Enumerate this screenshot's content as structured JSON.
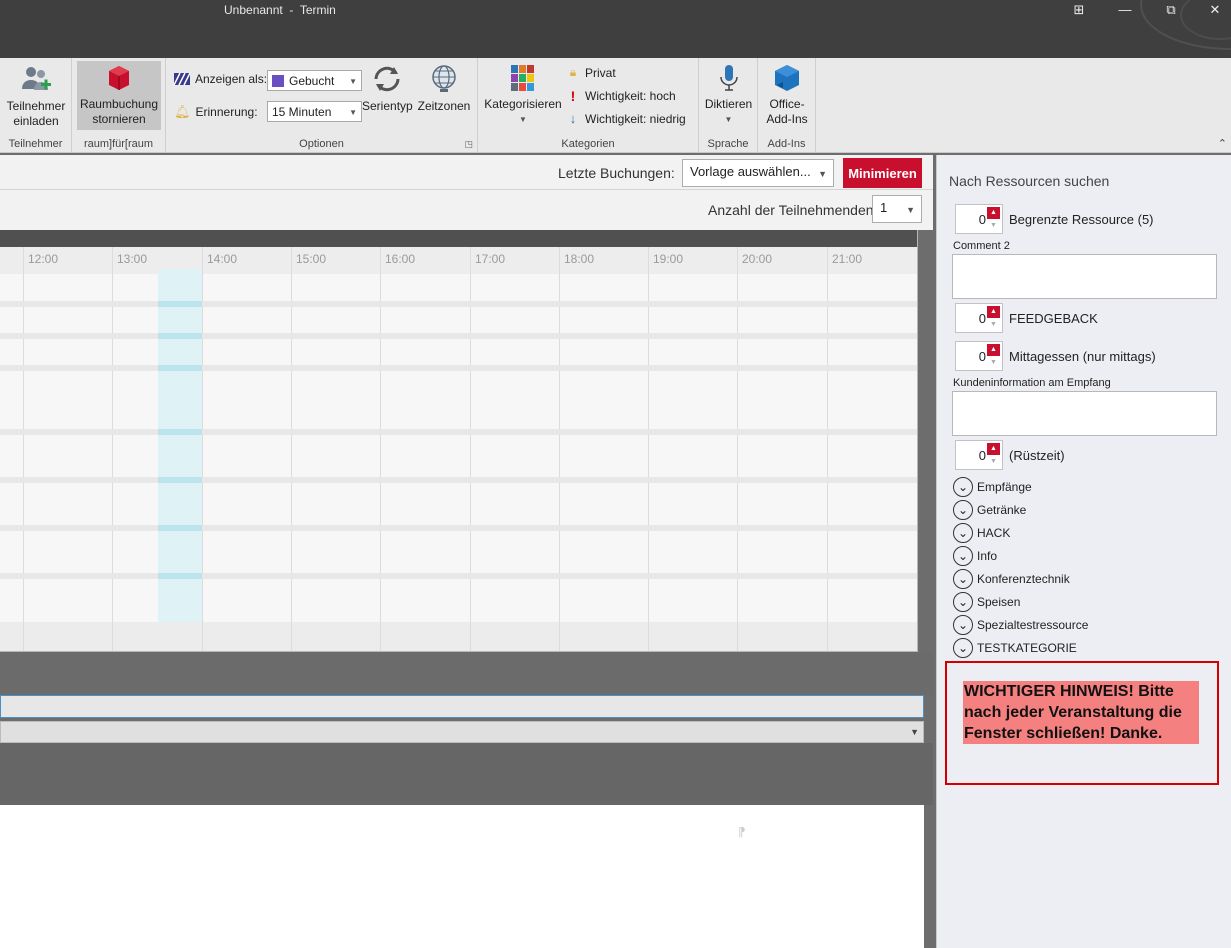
{
  "window": {
    "title": "Unbenannt  -  Termin",
    "controls": {
      "ribbon_display": "⊞",
      "minimize": "—",
      "restore": "⧉",
      "close": "✕"
    }
  },
  "ribbon": {
    "groups": {
      "teilnehmer": {
        "label": "Teilnehmer",
        "invite_line1": "Teilnehmer",
        "invite_line2": "einladen"
      },
      "raum": {
        "label": "raum]für[raum",
        "cancel_line1": "Raumbuchung",
        "cancel_line2": "stornieren"
      },
      "optionen": {
        "label": "Optionen",
        "anzeigen_label": "Anzeigen als:",
        "anzeigen_value": "Gebucht",
        "erinnerung_label": "Erinnerung:",
        "erinnerung_value": "15 Minuten",
        "serientyp": "Serientyp",
        "zeitzonen": "Zeitzonen"
      },
      "kategorien": {
        "label": "Kategorien",
        "kategorisieren": "Kategorisieren",
        "privat": "Privat",
        "wichtigkeit_hoch": "Wichtigkeit: hoch",
        "wichtigkeit_niedrig": "Wichtigkeit: niedrig"
      },
      "sprache": {
        "label": "Sprache",
        "diktieren": "Diktieren"
      },
      "addins": {
        "label": "Add-Ins",
        "line1": "Office-",
        "line2": "Add-Ins"
      }
    }
  },
  "booking": {
    "letzte_label": "Letzte Buchungen:",
    "vorlage_value": "Vorlage auswählen...",
    "minimize_button": "Minimieren",
    "teilnehmende_label": "Anzahl der Teilnehmenden",
    "teilnehmende_value": "1"
  },
  "timeline": {
    "hours": [
      "12:00",
      "13:00",
      "14:00",
      "15:00",
      "16:00",
      "17:00",
      "18:00",
      "19:00",
      "20:00",
      "21:00"
    ]
  },
  "resources": {
    "title": "Nach Ressourcen suchen",
    "spinners": [
      {
        "value": "0",
        "label": "Begrenzte Ressource (5)"
      },
      {
        "value": "0",
        "label": "FEEDGEBACK"
      },
      {
        "value": "0",
        "label": "Mittagessen (nur mittags)"
      },
      {
        "value": "0",
        "label": "(Rüstzeit)"
      }
    ],
    "comment2_label": "Comment 2",
    "kundeninfo_label": "Kundeninformation am Empfang",
    "categories": [
      "Empfänge",
      "Getränke",
      "HACK",
      "Info",
      "Konferenztechnik",
      "Speisen",
      "Spezialtestressource",
      "TESTKATEGORIE"
    ],
    "notice": "WICHTIGER HINWEIS! Bitte nach jeder Veranstaltung die Fenster schließen! Danke."
  },
  "colors": {
    "accent_red": "#c8102e",
    "notice_bg": "#f58080",
    "notice_border": "#d40000"
  }
}
